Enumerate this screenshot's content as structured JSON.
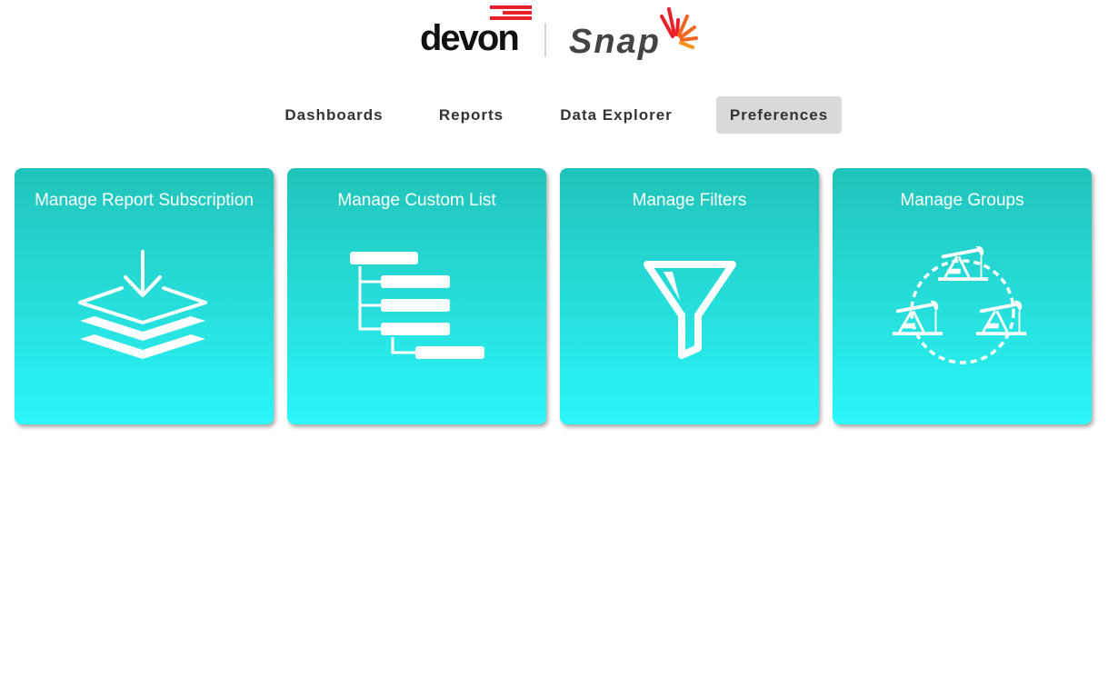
{
  "brand": {
    "company": "devon",
    "product": "Snap",
    "colors": {
      "devon_red": "#e8202a",
      "snap_orange": "#f26522",
      "snap_text": "#444444"
    }
  },
  "nav": {
    "items": [
      {
        "label": "Dashboards",
        "active": false
      },
      {
        "label": "Reports",
        "active": false
      },
      {
        "label": "Data Explorer",
        "active": false
      },
      {
        "label": "Preferences",
        "active": true
      }
    ]
  },
  "cards": [
    {
      "title": "Manage Report Subscription",
      "icon": "layers-download-icon"
    },
    {
      "title": "Manage Custom List",
      "icon": "tree-list-icon"
    },
    {
      "title": "Manage Filters",
      "icon": "funnel-icon"
    },
    {
      "title": "Manage Groups",
      "icon": "pumpjack-cycle-icon"
    }
  ],
  "theme": {
    "card_top": "#21c3b9",
    "card_bottom": "#2bf6f9",
    "active_tab_bg": "#d9d9d9"
  }
}
